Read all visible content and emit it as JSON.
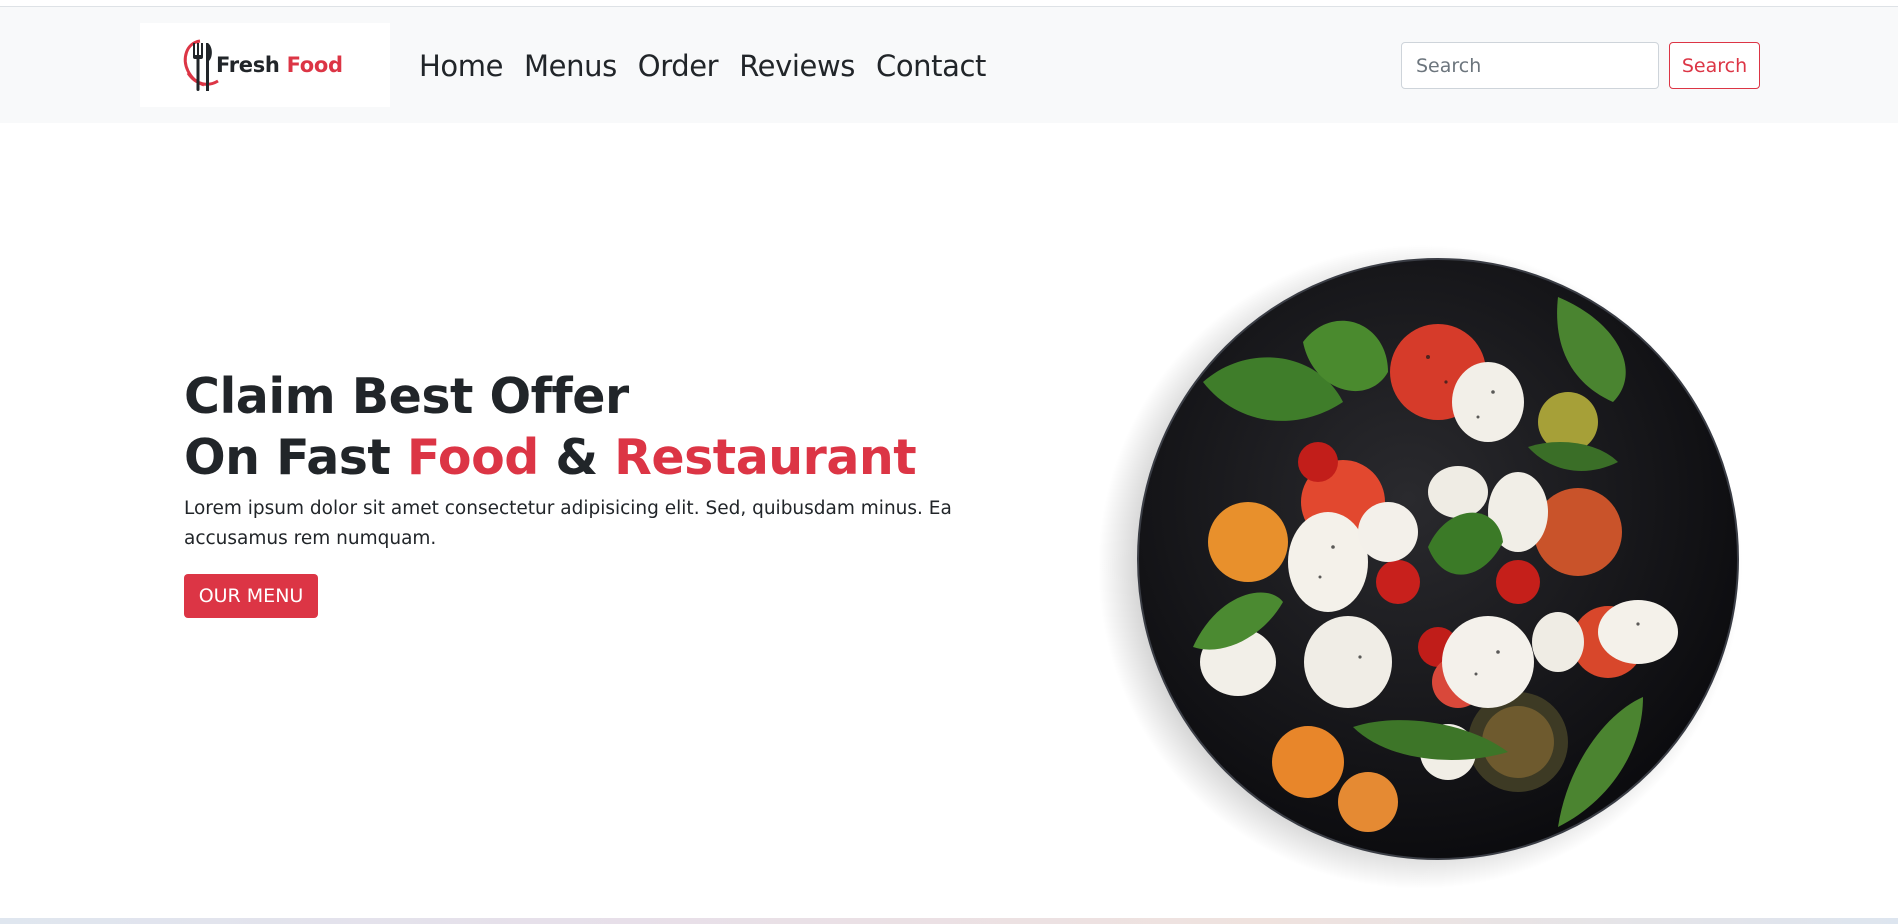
{
  "brand": {
    "logo_word_1": "Fresh",
    "logo_word_2": "Food",
    "accent_color": "#dc3545",
    "icon": "fork-knife-icon"
  },
  "nav": {
    "items": [
      {
        "label": "Home"
      },
      {
        "label": "Menus"
      },
      {
        "label": "Order"
      },
      {
        "label": "Reviews"
      },
      {
        "label": "Contact"
      }
    ]
  },
  "search": {
    "placeholder": "Search",
    "value": "",
    "button_label": "Search"
  },
  "hero": {
    "line1": "Claim Best Offer",
    "line2_prefix": "On Fast ",
    "line2_highlight_1": "Food",
    "line2_mid": " & ",
    "line2_highlight_2": "Restaurant",
    "description": "Lorem ipsum dolor sit amet consectetur adipisicing elit. Sed, quibusdam minus. Ea accusamus rem numquam.",
    "button_label": "OUR MENU",
    "image": "salad-plate-image"
  }
}
